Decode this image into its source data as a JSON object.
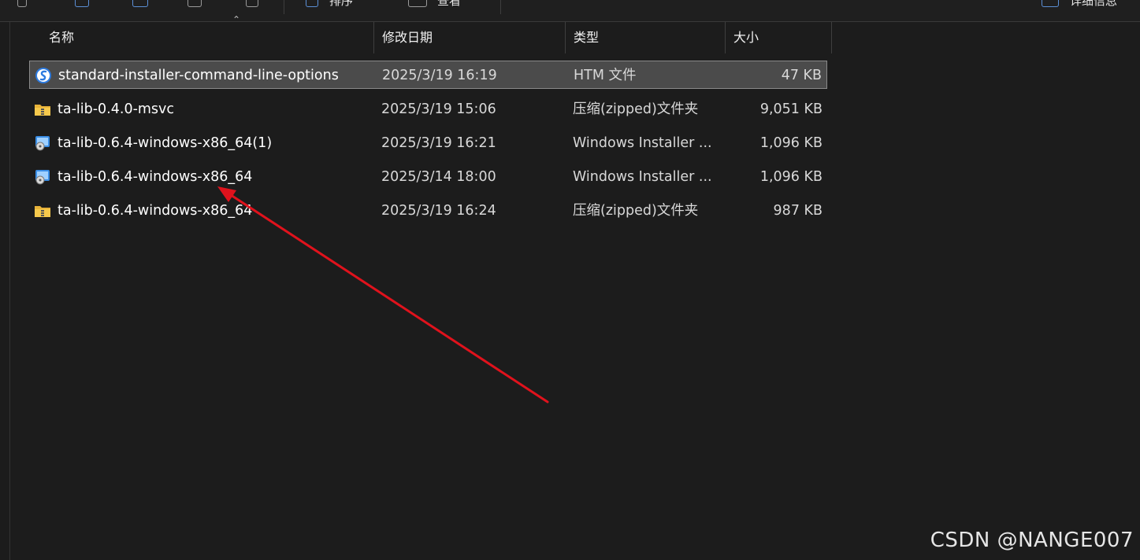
{
  "toolbar": {
    "sort_label": "排序",
    "view_label": "查看",
    "details_label": "详细信息"
  },
  "columns": {
    "name": "名称",
    "date": "修改日期",
    "type": "类型",
    "size": "大小"
  },
  "files": [
    {
      "name": "standard-installer-command-line-options",
      "date": "2025/3/19 16:19",
      "type": "HTM 文件",
      "size": "47 KB",
      "icon": "browser-file-icon",
      "selected": true
    },
    {
      "name": "ta-lib-0.4.0-msvc",
      "date": "2025/3/19 15:06",
      "type": "压缩(zipped)文件夹",
      "size": "9,051 KB",
      "icon": "zip-folder-icon",
      "selected": false
    },
    {
      "name": "ta-lib-0.6.4-windows-x86_64(1)",
      "date": "2025/3/19 16:21",
      "type": "Windows Installer ...",
      "size": "1,096 KB",
      "icon": "installer-icon",
      "selected": false
    },
    {
      "name": "ta-lib-0.6.4-windows-x86_64",
      "date": "2025/3/14 18:00",
      "type": "Windows Installer ...",
      "size": "1,096 KB",
      "icon": "installer-icon",
      "selected": false
    },
    {
      "name": "ta-lib-0.6.4-windows-x86_64",
      "date": "2025/3/19 16:24",
      "type": "压缩(zipped)文件夹",
      "size": "987 KB",
      "icon": "zip-folder-icon",
      "selected": false
    }
  ],
  "annotation": {
    "color": "#e0121c",
    "icon": "red-arrow-annotation"
  },
  "watermark": "CSDN @NANGE007"
}
